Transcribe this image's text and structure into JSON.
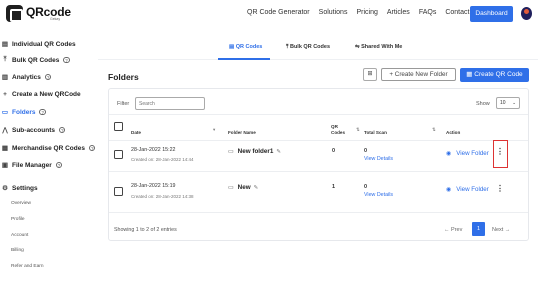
{
  "brand": {
    "name": "QRcode",
    "sub": "Gekay"
  },
  "nav": {
    "links": [
      "QR Code Generator",
      "Solutions",
      "Pricing",
      "Articles",
      "FAQs",
      "Contact Us"
    ],
    "dashboard_label": "Dashboard",
    "accent": "#2f6fe8"
  },
  "sidebar": {
    "items": [
      {
        "label": "Individual QR Codes",
        "icon": "list-icon",
        "glyph": "▤",
        "help": false,
        "bold": true
      },
      {
        "label": "Bulk QR Codes",
        "icon": "upload-icon",
        "glyph": "⤒",
        "help": true,
        "bold": true
      },
      {
        "label": "Analytics",
        "icon": "bar-chart-icon",
        "glyph": "▥",
        "help": true,
        "bold": true
      },
      {
        "label": "Create a New QRCode",
        "icon": "plus-icon",
        "glyph": "+",
        "help": false,
        "bold": true
      },
      {
        "label": "Folders",
        "icon": "folder-icon",
        "glyph": "▭",
        "help": true,
        "bold": true,
        "active": true
      },
      {
        "label": "Sub-accounts",
        "icon": "users-icon",
        "glyph": "⋀",
        "help": true,
        "bold": true
      },
      {
        "label": "Merchandise QR Codes",
        "icon": "shop-icon",
        "glyph": "▦",
        "help": true,
        "bold": true
      },
      {
        "label": "File Manager",
        "icon": "file-icon",
        "glyph": "▣",
        "help": true,
        "bold": true
      }
    ],
    "settings": {
      "label": "Settings",
      "glyph": "⚙",
      "sub": [
        "Overview",
        "Profile",
        "Account",
        "Billing",
        "Refer and Earn"
      ]
    }
  },
  "tabs": [
    {
      "label": "QR Codes",
      "glyph": "▤",
      "active": true
    },
    {
      "label": "Bulk QR Codes",
      "glyph": "⤒",
      "active": false
    },
    {
      "label": "Shared With Me",
      "glyph": "⇋",
      "active": false
    }
  ],
  "page": {
    "title": "Folders",
    "grid_glyph": "⊞",
    "new_folder_label": "Create New Folder",
    "create_qr_label": "Create QR Code"
  },
  "filter": {
    "label": "Filter",
    "placeholder": "Search"
  },
  "show": {
    "label": "Show",
    "value": "10"
  },
  "table": {
    "headers": {
      "date": "Date",
      "folder_name": "Folder Name",
      "qr_codes": "QR Codes",
      "total_scan": "Total Scan",
      "action": "Action"
    },
    "rows": [
      {
        "date": "28-Jan-2022 15:22",
        "created": "Created on: 28-Jan-2022 14:44",
        "folder_name": "New folder1",
        "qr_codes": "0",
        "total_scan": "0",
        "view_details": "View Details",
        "view_folder": "View Folder"
      },
      {
        "date": "28-Jan-2022 15:19",
        "created": "Created on: 28-Jan-2022 14:38",
        "folder_name": "New",
        "qr_codes": "1",
        "total_scan": "0",
        "view_details": "View Details",
        "view_folder": "View Folder"
      }
    ]
  },
  "pagination": {
    "entries_text": "Showing 1 to 2 of 2 entries",
    "prev": "Prev",
    "current": "1",
    "next": "Next"
  }
}
